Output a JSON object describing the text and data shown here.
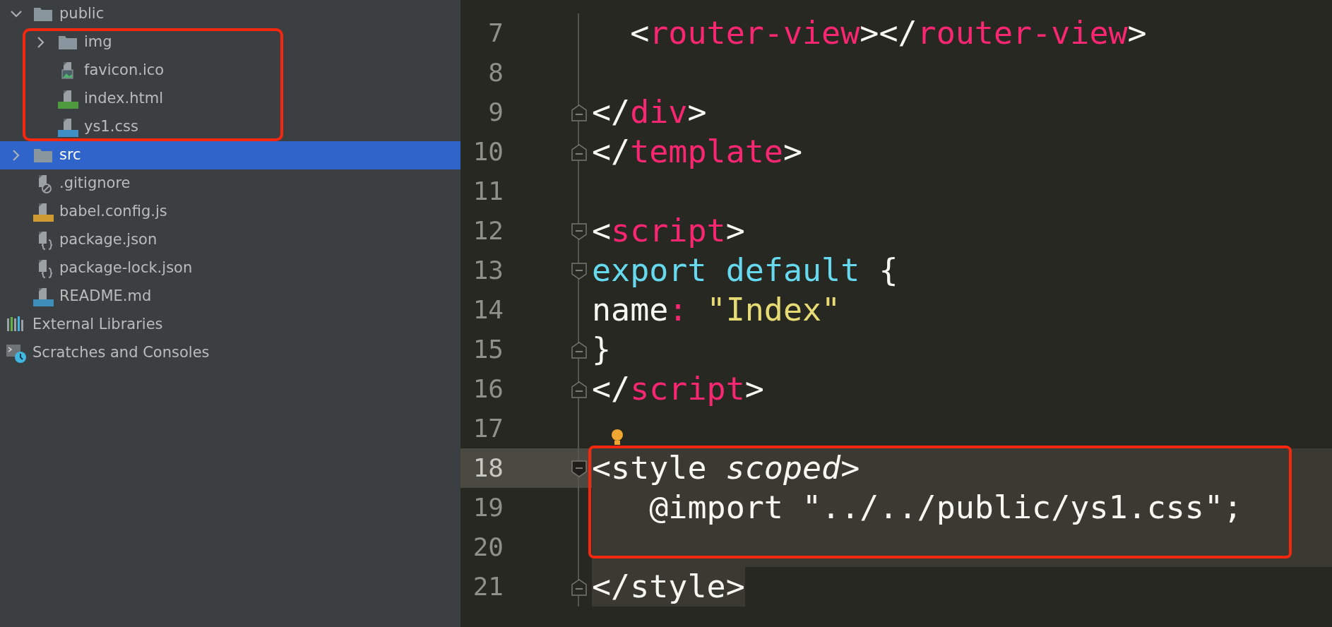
{
  "sidebar": {
    "items": [
      {
        "label": "public",
        "kind": "folder",
        "expanded": true,
        "selected": false,
        "highlighted": false,
        "children": [
          {
            "label": "img",
            "kind": "folder",
            "expanded": false,
            "selected": false,
            "highlighted": true
          },
          {
            "label": "favicon.ico",
            "kind": "image-file",
            "selected": false,
            "highlighted": true
          },
          {
            "label": "index.html",
            "kind": "html-file",
            "selected": false,
            "highlighted": true
          },
          {
            "label": "ys1.css",
            "kind": "css-file",
            "selected": false,
            "highlighted": true
          }
        ]
      },
      {
        "label": "src",
        "kind": "folder",
        "expanded": false,
        "selected": true,
        "highlighted": false
      },
      {
        "label": ".gitignore",
        "kind": "ignore-file",
        "selected": false,
        "highlighted": false
      },
      {
        "label": "babel.config.js",
        "kind": "js-file",
        "selected": false,
        "highlighted": false
      },
      {
        "label": "package.json",
        "kind": "json-file",
        "selected": false,
        "highlighted": false
      },
      {
        "label": "package-lock.json",
        "kind": "json-file",
        "selected": false,
        "highlighted": false
      },
      {
        "label": "README.md",
        "kind": "md-file",
        "selected": false,
        "highlighted": false
      }
    ],
    "extra_items": [
      {
        "label": "External Libraries",
        "kind": "libraries",
        "selected": false
      },
      {
        "label": "Scratches and Consoles",
        "kind": "scratches",
        "selected": false
      }
    ]
  },
  "editor": {
    "lines": [
      {
        "number": "7",
        "kind": "plain",
        "current": false,
        "highlighted": false,
        "shaded": false,
        "matched": false,
        "tokens": [
          {
            "kind": "punct",
            "text": "  <"
          },
          {
            "kind": "tag",
            "text": "router-view"
          },
          {
            "kind": "punct",
            "text": "></"
          },
          {
            "kind": "tag",
            "text": "router-view"
          },
          {
            "kind": "punct",
            "text": ">"
          }
        ]
      },
      {
        "number": "8",
        "kind": "plain",
        "current": false,
        "highlighted": false,
        "shaded": false
      },
      {
        "number": "9",
        "kind": "fold-end",
        "current": false,
        "highlighted": false,
        "shaded": false,
        "matched": false,
        "tokens": [
          {
            "kind": "punct",
            "text": "</"
          },
          {
            "kind": "tag",
            "text": "div"
          },
          {
            "kind": "punct",
            "text": ">"
          }
        ]
      },
      {
        "number": "10",
        "kind": "fold-end",
        "current": false,
        "highlighted": false,
        "shaded": false,
        "matched": false,
        "tokens": [
          {
            "kind": "punct",
            "text": "</"
          },
          {
            "kind": "tag",
            "text": "template"
          },
          {
            "kind": "punct",
            "text": ">"
          }
        ]
      },
      {
        "number": "11",
        "kind": "plain",
        "current": false,
        "highlighted": false,
        "shaded": false
      },
      {
        "number": "12",
        "kind": "fold-start",
        "current": false,
        "highlighted": false,
        "shaded": false,
        "matched": false,
        "tokens": [
          {
            "kind": "punct",
            "text": "<"
          },
          {
            "kind": "tag",
            "text": "script"
          },
          {
            "kind": "punct",
            "text": ">"
          }
        ]
      },
      {
        "number": "13",
        "kind": "fold-start",
        "current": false,
        "highlighted": false,
        "shaded": false,
        "matched": false,
        "tokens": [
          {
            "kind": "keyword",
            "text": "export default"
          },
          {
            "kind": "punct",
            "text": " {"
          }
        ]
      },
      {
        "number": "14",
        "kind": "plain",
        "current": false,
        "highlighted": false,
        "shaded": false,
        "matched": false,
        "tokens": [
          {
            "kind": "plain",
            "text": "name"
          },
          {
            "kind": "tag",
            "text": ":"
          },
          {
            "kind": "string",
            "text": " \"Index\""
          }
        ]
      },
      {
        "number": "15",
        "kind": "fold-end",
        "current": false,
        "highlighted": false,
        "shaded": false,
        "matched": false,
        "tokens": [
          {
            "kind": "punct",
            "text": "}"
          }
        ]
      },
      {
        "number": "16",
        "kind": "fold-end",
        "current": false,
        "highlighted": false,
        "shaded": false,
        "matched": false,
        "tokens": [
          {
            "kind": "punct",
            "text": "</"
          },
          {
            "kind": "tag",
            "text": "script"
          },
          {
            "kind": "punct",
            "text": ">"
          }
        ]
      },
      {
        "number": "17",
        "kind": "plain",
        "current": false,
        "highlighted": false,
        "shaded": false,
        "bulb": true
      },
      {
        "number": "18",
        "kind": "fold-start",
        "current": true,
        "highlighted": true,
        "shaded": true,
        "matched": false,
        "tokens": [
          {
            "kind": "plain",
            "text": "<style "
          },
          {
            "kind": "attr",
            "text": "scoped"
          },
          {
            "kind": "plain",
            "text": ">"
          }
        ]
      },
      {
        "number": "19",
        "kind": "plain",
        "current": false,
        "highlighted": true,
        "shaded": true,
        "matched": false,
        "tokens": [
          {
            "kind": "plain",
            "text": "   @import \"../../public/ys1.css\";"
          }
        ]
      },
      {
        "number": "20",
        "kind": "plain",
        "current": false,
        "highlighted": true,
        "shaded": true
      },
      {
        "number": "21",
        "kind": "fold-end",
        "current": false,
        "highlighted": false,
        "shaded": false,
        "matched": true,
        "tokens": [
          {
            "kind": "plain",
            "text": "</style>"
          }
        ]
      }
    ]
  }
}
